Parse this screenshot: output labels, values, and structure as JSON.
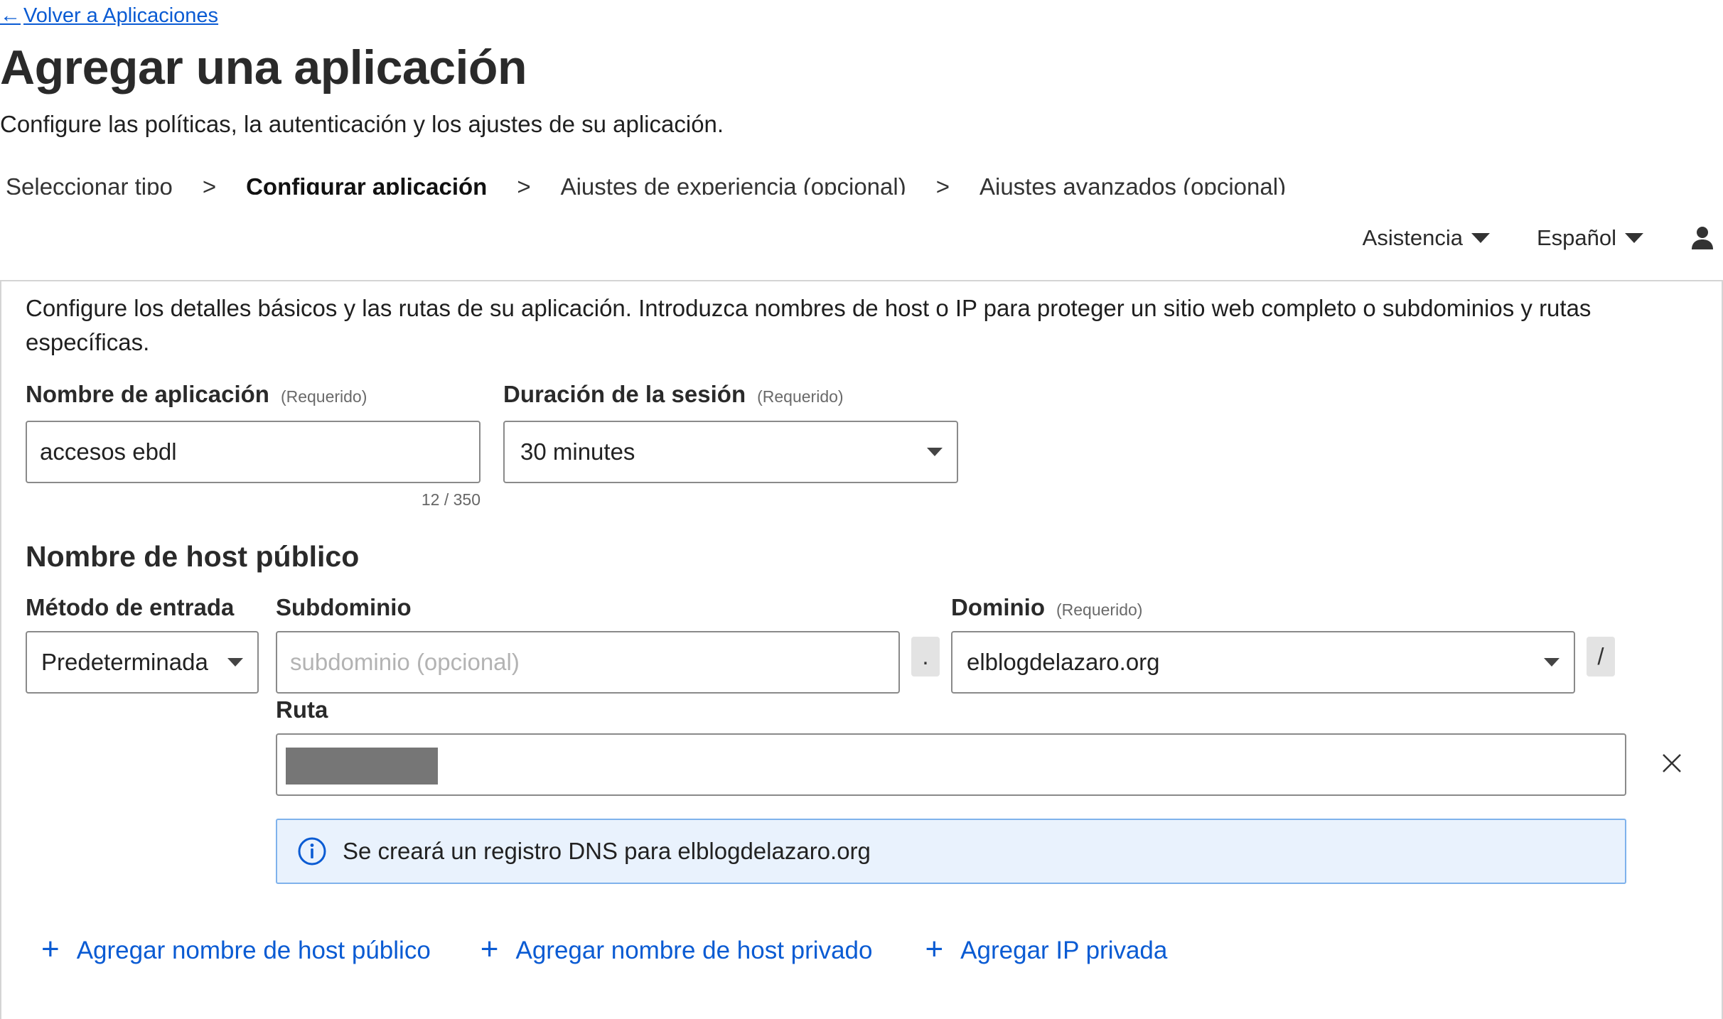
{
  "header": {
    "back_arrow": "←",
    "back_label": "Volver a Aplicaciones",
    "title": "Agregar una aplicación",
    "subtitle": "Configure las políticas, la autenticación y los ajustes de su aplicación."
  },
  "stepper": {
    "separator": ">",
    "steps": [
      {
        "label": "Seleccionar tipo",
        "active": false
      },
      {
        "label": "Configurar aplicación",
        "active": true
      },
      {
        "label": "Ajustes de experiencia (opcional)",
        "active": false
      },
      {
        "label": "Ajustes avanzados (opcional)",
        "active": false
      }
    ]
  },
  "topbar": {
    "support_label": "Asistencia",
    "language_label": "Español",
    "user_icon": "user-icon"
  },
  "form": {
    "intro": "Configure los detalles básicos y las rutas de su aplicación. Introduzca nombres de host o IP para proteger un sitio web completo o subdominios y rutas específicas.",
    "required_tag": "(Requerido)",
    "app_name": {
      "label": "Nombre de aplicación",
      "value": "accesos ebdl",
      "counter": "12 / 350"
    },
    "session_duration": {
      "label": "Duración de la sesión",
      "value": "30 minutes"
    },
    "public_hostname": {
      "section_title": "Nombre de host público",
      "input_method": {
        "label": "Método de entrada",
        "value": "Predeterminada"
      },
      "subdomain": {
        "label": "Subdominio",
        "placeholder": "subdominio (opcional)"
      },
      "dot": ".",
      "domain": {
        "label": "Dominio",
        "value": "elblogdelazaro.org"
      },
      "slash": "/",
      "path": {
        "label": "Ruta"
      },
      "dns_notice": "Se creará un registro DNS para elblogdelazaro.org"
    },
    "add_actions": {
      "plus": "+",
      "public_hostname": "Agregar nombre de host público",
      "private_hostname": "Agregar nombre de host privado",
      "private_ip": "Agregar IP privada"
    }
  },
  "colors": {
    "link": "#0a5bd3",
    "info_background": "#e9f2fd",
    "info_border": "#7fb2ec",
    "border": "#8a8a8a"
  }
}
